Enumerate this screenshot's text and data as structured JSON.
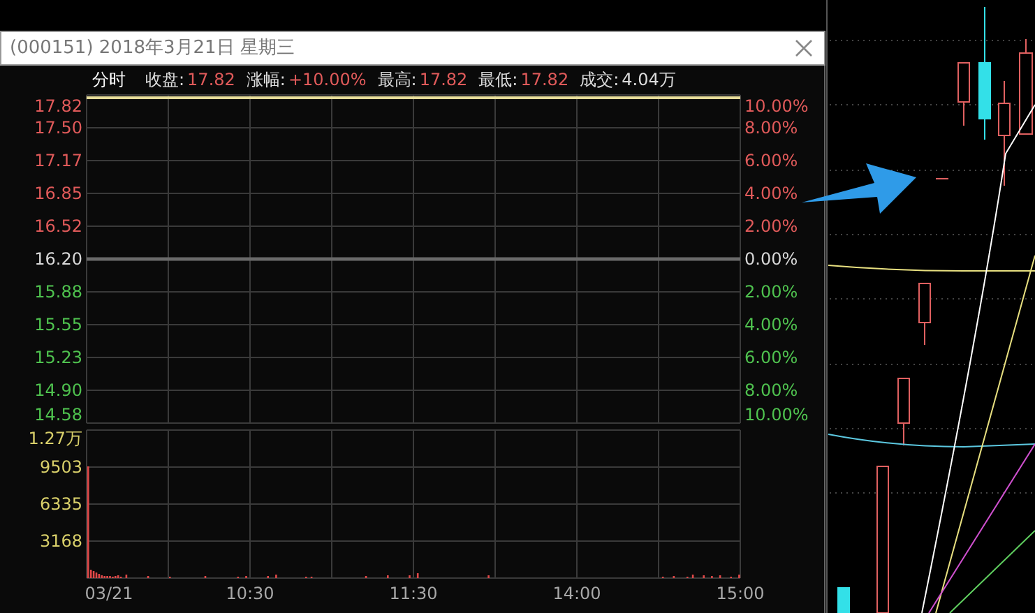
{
  "window": {
    "title": "(000151) 2018年3月21日 星期三"
  },
  "info_bar": {
    "mode": "分时",
    "stats": [
      {
        "label": "收盘:",
        "value": "17.82",
        "kind": "up"
      },
      {
        "label": "涨幅:",
        "value": "+10.00%",
        "kind": "up"
      },
      {
        "label": "最高:",
        "value": "17.82",
        "kind": "up"
      },
      {
        "label": "最低:",
        "value": "17.82",
        "kind": "up"
      },
      {
        "label": "成交:",
        "value": "4.04万",
        "kind": "plain"
      }
    ]
  },
  "price_chart": {
    "left_axis": [
      {
        "text": "17.82",
        "kind": "up"
      },
      {
        "text": "17.50",
        "kind": "up"
      },
      {
        "text": "17.17",
        "kind": "up"
      },
      {
        "text": "16.85",
        "kind": "up"
      },
      {
        "text": "16.52",
        "kind": "up"
      },
      {
        "text": "16.20",
        "kind": "flat"
      },
      {
        "text": "15.88",
        "kind": "down"
      },
      {
        "text": "15.55",
        "kind": "down"
      },
      {
        "text": "15.23",
        "kind": "down"
      },
      {
        "text": "14.90",
        "kind": "down"
      },
      {
        "text": "14.58",
        "kind": "down"
      }
    ],
    "right_axis": [
      {
        "text": "10.00%",
        "kind": "up"
      },
      {
        "text": "8.00%",
        "kind": "up"
      },
      {
        "text": "6.00%",
        "kind": "up"
      },
      {
        "text": "4.00%",
        "kind": "up"
      },
      {
        "text": "2.00%",
        "kind": "up"
      },
      {
        "text": "0.00%",
        "kind": "flat"
      },
      {
        "text": "2.00%",
        "kind": "down"
      },
      {
        "text": "4.00%",
        "kind": "down"
      },
      {
        "text": "6.00%",
        "kind": "down"
      },
      {
        "text": "8.00%",
        "kind": "down"
      },
      {
        "text": "10.00%",
        "kind": "down"
      }
    ]
  },
  "volume_chart": {
    "axis_labels": [
      "1.27万",
      "9503",
      "6335",
      "3168"
    ],
    "time_labels": [
      "03/21",
      "10:30",
      "11:30",
      "14:00",
      "15:00"
    ]
  }
}
